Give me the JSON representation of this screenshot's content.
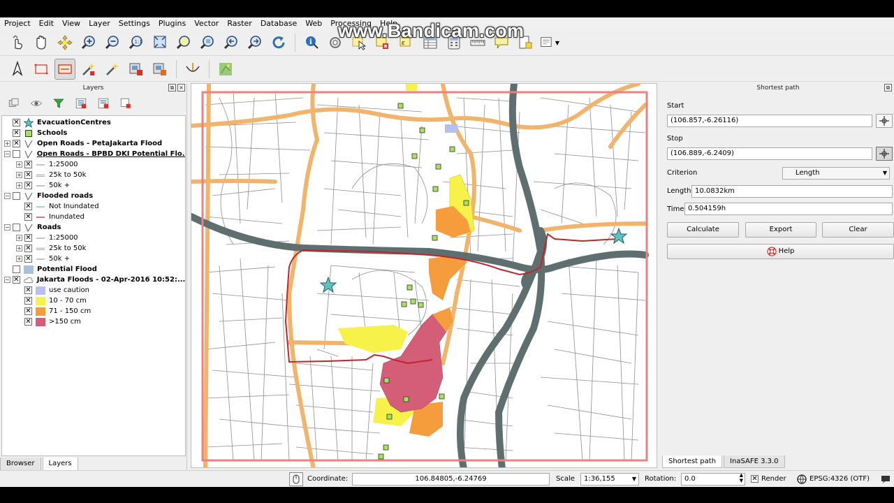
{
  "watermark": "www.Bandicam.com",
  "menu": [
    "Project",
    "Edit",
    "View",
    "Layer",
    "Settings",
    "Plugins",
    "Vector",
    "Raster",
    "Database",
    "Web",
    "Processing",
    "Help"
  ],
  "layers_panel": {
    "title": "Layers",
    "tree": [
      {
        "name": "EvacuationCentres",
        "checked": true,
        "expander": "",
        "symbol": "star",
        "bold": true
      },
      {
        "name": "Schools",
        "checked": true,
        "expander": "",
        "symbol": "square-green",
        "bold": true
      },
      {
        "name": "Open Roads - PetaJakarta Flood",
        "checked": true,
        "expander": "+",
        "symbol": "line-v",
        "bold": true
      },
      {
        "name": "Open Roads - BPBD DKI Potential Flo...",
        "checked": false,
        "expander": "−",
        "symbol": "line-v",
        "bold": true,
        "underline": true
      },
      {
        "name": "1:25000",
        "checked": true,
        "expander": "+",
        "symbol": "line-thin",
        "indent": 1
      },
      {
        "name": "25k to 50k",
        "checked": true,
        "expander": "+",
        "symbol": "line-double",
        "indent": 1
      },
      {
        "name": "50k +",
        "checked": true,
        "expander": "+",
        "symbol": "line-thin",
        "indent": 1
      },
      {
        "name": "Flooded roads",
        "checked": false,
        "expander": "−",
        "symbol": "line-v",
        "bold": true
      },
      {
        "name": "Not Inundated",
        "checked": true,
        "expander": "",
        "symbol": "line-green",
        "indent": 1
      },
      {
        "name": "Inundated",
        "checked": true,
        "expander": "",
        "symbol": "line-red",
        "indent": 1
      },
      {
        "name": "Roads",
        "checked": false,
        "expander": "−",
        "symbol": "line-v",
        "bold": true
      },
      {
        "name": "1:25000",
        "checked": true,
        "expander": "+",
        "symbol": "line-thin",
        "indent": 1
      },
      {
        "name": "25k to 50k",
        "checked": true,
        "expander": "+",
        "symbol": "line-double",
        "indent": 1
      },
      {
        "name": "50k +",
        "checked": true,
        "expander": "+",
        "symbol": "line-thin",
        "indent": 1
      },
      {
        "name": "Potential Flood",
        "checked": false,
        "expander": "",
        "symbol": "fill-blue",
        "bold": true
      },
      {
        "name": "Jakarta Floods - 02-Apr-2016 10:52:...",
        "checked": true,
        "expander": "−",
        "symbol": "cloud",
        "bold": true
      },
      {
        "name": "use caution",
        "checked": true,
        "expander": "",
        "symbol": "fill-lavender",
        "indent": 1
      },
      {
        "name": "10 - 70 cm",
        "checked": true,
        "expander": "",
        "symbol": "fill-yellow",
        "indent": 1
      },
      {
        "name": "71 - 150 cm",
        "checked": true,
        "expander": "",
        "symbol": "fill-orange",
        "indent": 1
      },
      {
        "name": ">150 cm",
        "checked": true,
        "expander": "",
        "symbol": "fill-red",
        "indent": 1
      }
    ],
    "tabs": [
      "Browser",
      "Layers"
    ]
  },
  "shortest_path": {
    "title": "Shortest path",
    "start_label": "Start",
    "start_value": "(106.857,-6.26116)",
    "stop_label": "Stop",
    "stop_value": "(106.889,-6.2409)",
    "criterion_label": "Criterion",
    "criterion_value": "Length",
    "length_label": "Length",
    "length_value": "10.0832km",
    "time_label": "Time",
    "time_value": "0.504159h",
    "calculate": "Calculate",
    "export": "Export",
    "clear": "Clear",
    "help": "Help",
    "tabs": [
      "Shortest path",
      "InaSAFE 3.3.0"
    ]
  },
  "status": {
    "coordinate_label": "Coordinate:",
    "coordinate_value": "106.84805,-6.24769",
    "scale_label": "Scale",
    "scale_value": "1:36,155",
    "rotation_label": "Rotation:",
    "rotation_value": "0.0",
    "render_label": "Render",
    "crs": "EPSG:4326 (OTF)"
  },
  "colors": {
    "major_road": "#5f6f6f",
    "arterial_road": "#f2b46a",
    "route": "#c0242c",
    "flood_yellow": "#f7f24a",
    "flood_orange": "#f59d3c",
    "flood_red": "#d45e78",
    "use_caution": "#b9c0ef",
    "school": "#a7e25c",
    "evac": "#5fc1c1"
  }
}
